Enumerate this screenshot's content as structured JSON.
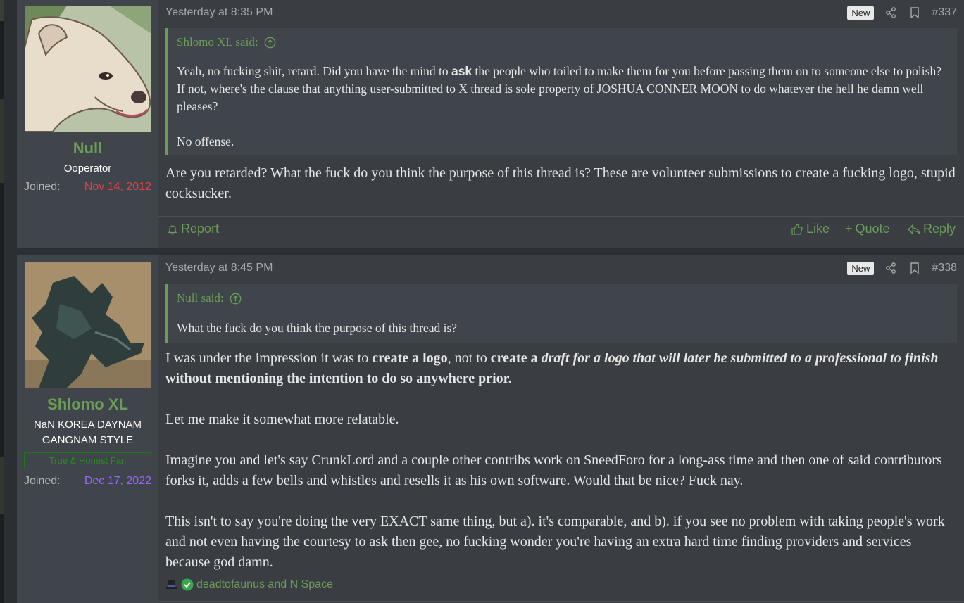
{
  "posts": [
    {
      "author": "Null",
      "user_title": "Ooperator",
      "joined_label": "Joined:",
      "joined_date": "Nov 14, 2012",
      "joined_color": "#e0414a",
      "date": "Yesterday at 8:35 PM",
      "new_badge": "New",
      "number": "#337",
      "quote": {
        "author": "Shlomo XL said:",
        "paragraphs": [
          [
            "Yeah, no fucking shit, retard. Did you have the mind to ",
            "ask",
            " the people who toiled to make them for you before passing them on to someone else to polish? If not, where's the clause that anything user-submitted to X thread is sole property of JOSHUA CONNER MOON to do whatever the hell he damn well pleases?"
          ],
          "No offense."
        ]
      },
      "message": "Are you retarded? What the fuck do you think the purpose of this thread is? These are volunteer submissions to create a fucking logo, stupid cocksucker.",
      "actions": {
        "report": "Report",
        "like": "Like",
        "quote": "Quote",
        "reply": "Reply"
      }
    },
    {
      "author": "Shlomo XL",
      "user_title_line1": "NaN KOREA DAYNAM",
      "user_title_line2": "GANGNAM STYLE",
      "banner": "True & Honest Fan",
      "joined_label": "Joined:",
      "joined_date": "Dec 17, 2022",
      "joined_color": "#9966ff",
      "date": "Yesterday at 8:45 PM",
      "new_badge": "New",
      "number": "#338",
      "quote": {
        "author": "Null said:",
        "text": "What the fuck do you think the purpose of this thread is?"
      },
      "message": {
        "p1": [
          "I was under the impression it was to ",
          "create a logo",
          ", not to ",
          "create a ",
          "draft for a logo that will later be submitted to a professional to finish",
          " without mentioning the intention to do so anywhere prior."
        ],
        "p2": "Let me make it somewhat more relatable.",
        "p3": "Imagine you and let's say CrunkLord and a couple other contribs work on SneedForo for a long-ass time and then one of said contributors forks it, adds a few bells and whistles and resells it as his own software. Would that be nice? Fuck nay.",
        "p4": "This isn't to say you're doing the very EXACT same thing, but a). it's comparable, and b). if you see no problem with taking people's work and not even having the courtesy to ask then gee, no fucking wonder you're having an extra hard time finding providers and services because god damn."
      },
      "reactions": "deadtofaunus and N Space"
    }
  ],
  "colors": {
    "accent_green": "#6a9d57",
    "post_bg": "#3a3d42",
    "sidebar_bg": "#40444b",
    "page_bg": "#2b2e33"
  }
}
